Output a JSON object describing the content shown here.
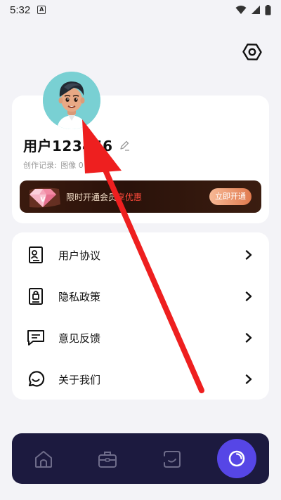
{
  "status_bar": {
    "time": "5:32",
    "notification_glyph": "A"
  },
  "profile": {
    "username": "用户123456",
    "record_label": "创作记录:",
    "record_value": "图像 0",
    "avatar_icon": "cartoon-boy-avatar"
  },
  "vip": {
    "text_before": "限时开通会员",
    "text_highlight": "享优惠",
    "button_label": "立即开通"
  },
  "menu": {
    "items": [
      {
        "label": "用户协议",
        "icon": "document-user-icon"
      },
      {
        "label": "隐私政策",
        "icon": "lock-document-icon"
      },
      {
        "label": "意见反馈",
        "icon": "chat-icon"
      },
      {
        "label": "关于我们",
        "icon": "whatsapp-like-icon"
      }
    ]
  },
  "tabbar": {
    "tabs": [
      {
        "name": "home",
        "active": false
      },
      {
        "name": "toolbox",
        "active": false
      },
      {
        "name": "gallery",
        "active": false
      },
      {
        "name": "profile",
        "active": true
      }
    ]
  },
  "colors": {
    "background": "#f3f3f7",
    "tabbar": "#1c1a3f",
    "active_tab": "#5646e6",
    "vip_highlight": "#ff4a3a",
    "annotation_arrow": "#ee1f1f"
  }
}
